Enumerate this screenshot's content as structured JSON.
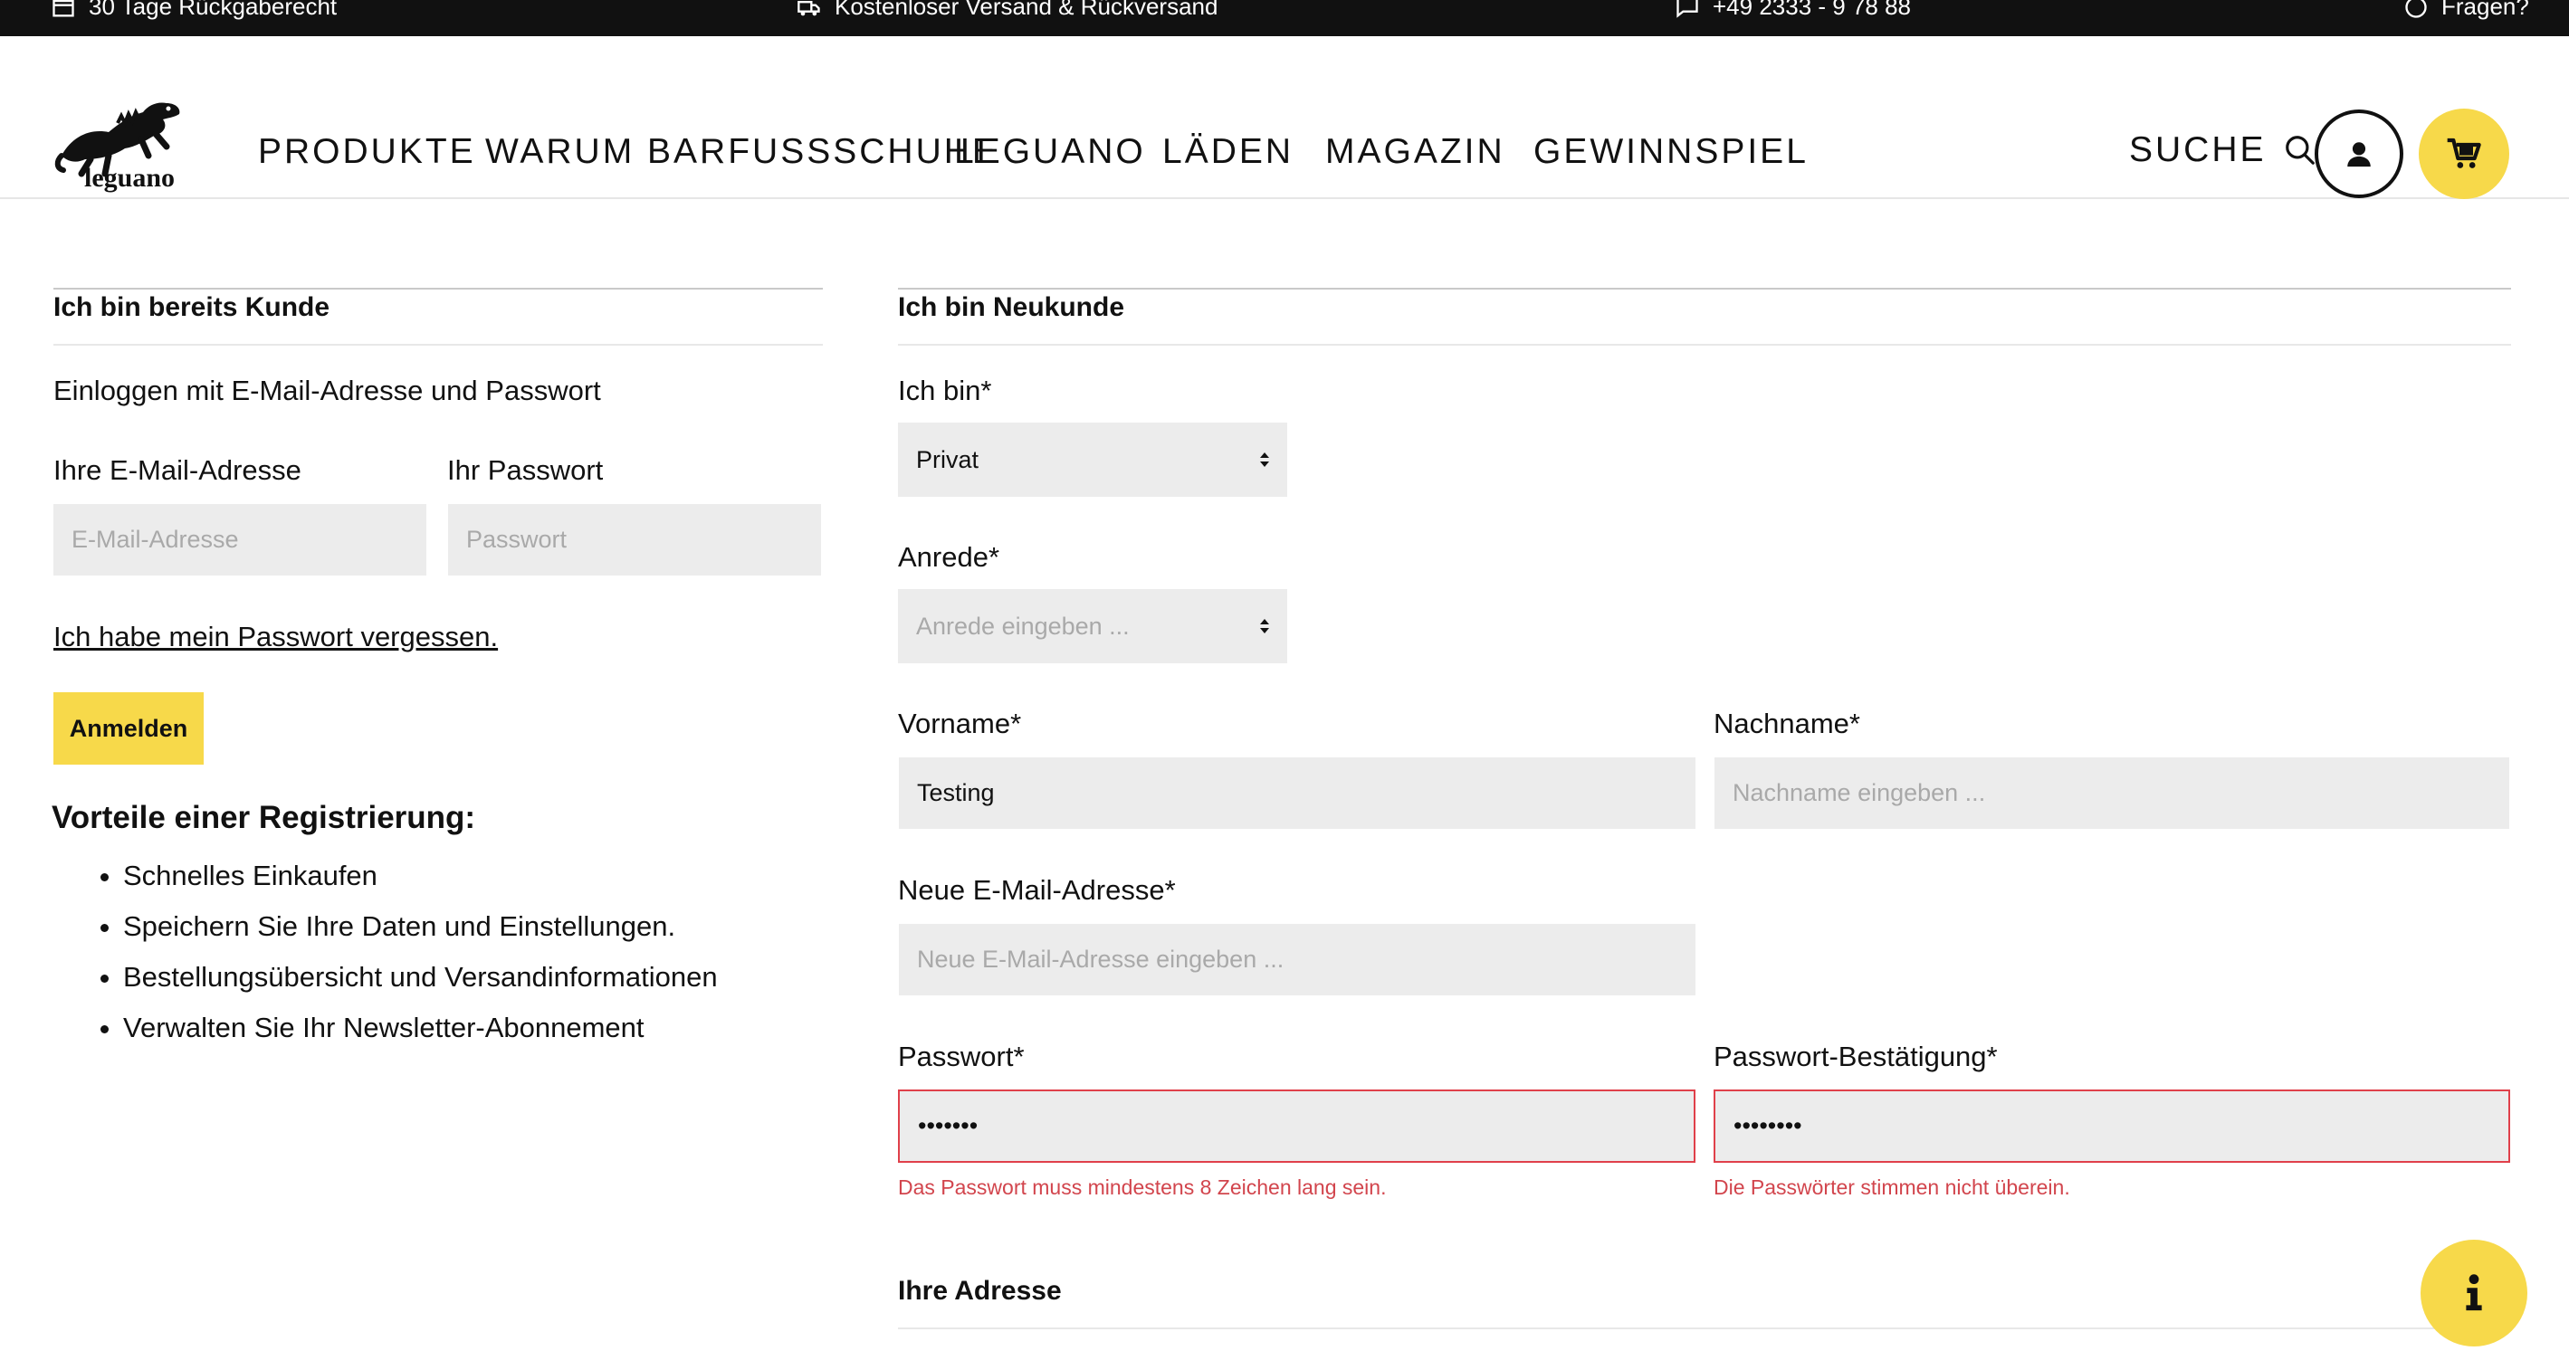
{
  "topbar": {
    "returns": "30 Tage Rückgaberecht",
    "shipping": "Kostenloser Versand & Rückversand",
    "phone": "+49 2333 - 9 78 88",
    "questions": "Fragen?"
  },
  "header": {
    "logo_text": "leguano",
    "nav": [
      "PRODUKTE",
      "WARUM BARFUSSSCHUHE",
      "LEGUANO",
      "LÄDEN",
      "MAGAZIN",
      "GEWINNSPIEL"
    ],
    "search_label": "SUCHE"
  },
  "login": {
    "title": "Ich bin bereits Kunde",
    "subtitle": "Einloggen mit E-Mail-Adresse und Passwort",
    "email_label": "Ihre E-Mail-Adresse",
    "email_placeholder": "E-Mail-Adresse",
    "password_label": "Ihr Passwort",
    "password_placeholder": "Passwort",
    "forgot_link": "Ich habe mein Passwort vergessen.",
    "submit": "Anmelden"
  },
  "benefits": {
    "title": "Vorteile einer Registrierung:",
    "items": [
      "Schnelles Einkaufen",
      "Speichern Sie Ihre Daten und Einstellungen.",
      "Bestellungsübersicht und Versandinformationen",
      "Verwalten Sie Ihr Newsletter-Abonnement"
    ]
  },
  "register": {
    "title": "Ich bin Neukunde",
    "type_label": "Ich bin*",
    "type_value": "Privat",
    "salutation_label": "Anrede*",
    "salutation_placeholder": "Anrede eingeben ...",
    "firstname_label": "Vorname*",
    "firstname_value": "Testing",
    "lastname_label": "Nachname*",
    "lastname_placeholder": "Nachname eingeben ...",
    "email_label": "Neue E-Mail-Adresse*",
    "email_placeholder": "Neue E-Mail-Adresse eingeben ...",
    "password_label": "Passwort*",
    "password_value": "1234567",
    "password_error": "Das Passwort muss mindestens 8 Zeichen lang sein.",
    "password_confirm_label": "Passwort-Bestätigung*",
    "password_confirm_value": "12345678",
    "password_confirm_error": "Die Passwörter stimmen nicht überein.",
    "address_title": "Ihre Adresse"
  },
  "colors": {
    "accent": "#f7d94a",
    "error": "#d2454d",
    "field_bg": "#ececec"
  },
  "icons": [
    "box-icon",
    "truck-icon",
    "chat-icon",
    "question-icon",
    "search-icon",
    "user-icon",
    "cart-icon",
    "info-icon"
  ]
}
